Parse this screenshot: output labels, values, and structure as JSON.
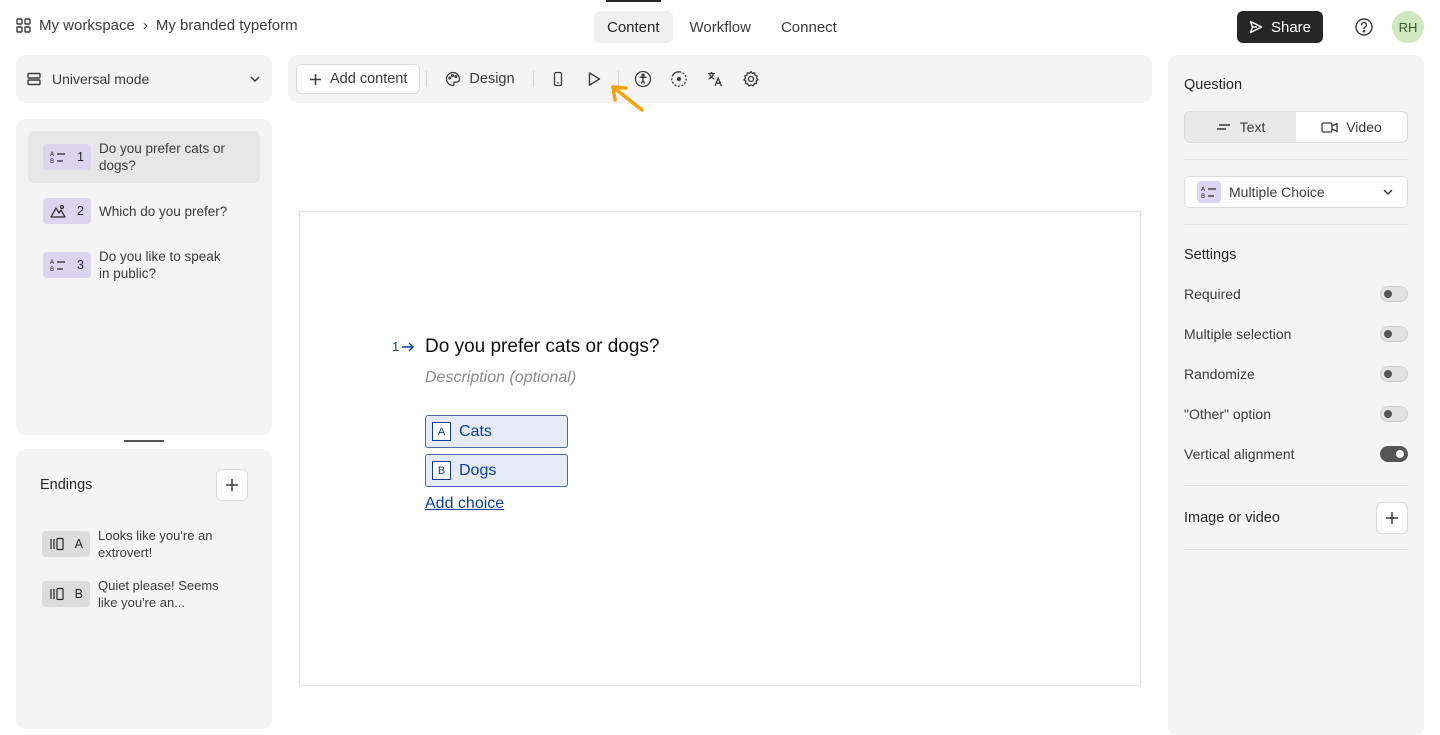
{
  "breadcrumb": {
    "workspace": "My workspace",
    "separator": "›",
    "form_name": "My branded typeform"
  },
  "nav_tabs": [
    {
      "label": "Content",
      "active": true
    },
    {
      "label": "Workflow",
      "active": false
    },
    {
      "label": "Connect",
      "active": false
    }
  ],
  "share_label": "Share",
  "avatar_initials": "RH",
  "mode_label": "Universal mode",
  "questions": [
    {
      "number": "1",
      "text": "Do you prefer cats or dogs?",
      "icon": "list-icon"
    },
    {
      "number": "2",
      "text": "Which do you prefer?",
      "icon": "image-choice-icon"
    },
    {
      "number": "3",
      "text": "Do you like to speak in public?",
      "icon": "list-icon"
    }
  ],
  "endings": {
    "title": "Endings",
    "items": [
      {
        "letter": "A",
        "text": "Looks like you're an extrovert!"
      },
      {
        "letter": "B",
        "text": "Quiet please! Seems like you're an..."
      }
    ]
  },
  "toolbar": {
    "add_content": "Add content",
    "design": "Design"
  },
  "canvas": {
    "question_number": "1",
    "question_title": "Do you prefer cats or dogs?",
    "description_placeholder": "Description (optional)",
    "choices": [
      {
        "key": "A",
        "label": "Cats"
      },
      {
        "key": "B",
        "label": "Dogs"
      }
    ],
    "add_choice": "Add choice"
  },
  "right_panel": {
    "question_heading": "Question",
    "seg_text": "Text",
    "seg_video": "Video",
    "question_type": "Multiple Choice",
    "settings_heading": "Settings",
    "settings": [
      {
        "label": "Required",
        "on": false
      },
      {
        "label": "Multiple selection",
        "on": false
      },
      {
        "label": "Randomize",
        "on": false
      },
      {
        "label": "\"Other\" option",
        "on": false
      },
      {
        "label": "Vertical alignment",
        "on": true
      }
    ],
    "image_or_video": "Image or video"
  },
  "colors": {
    "accent_blue": "#0a3fa0",
    "choice_bg": "#e6eaf5",
    "annotation_arrow": "#f5a30c",
    "badge_purple": "#dcd5f2"
  }
}
